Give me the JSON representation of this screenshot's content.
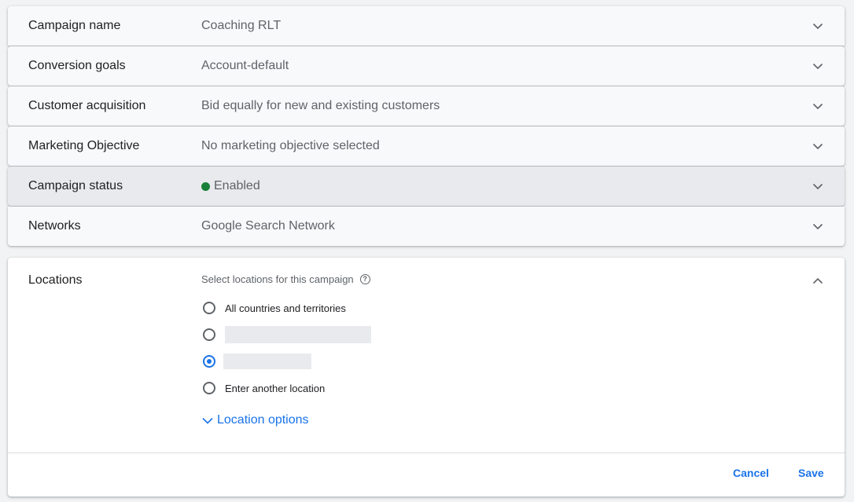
{
  "settings": [
    {
      "label": "Campaign name",
      "value": "Coaching RLT"
    },
    {
      "label": "Conversion goals",
      "value": "Account-default"
    },
    {
      "label": "Customer acquisition",
      "value": "Bid equally for new and existing customers"
    },
    {
      "label": "Marketing Objective",
      "value": "No marketing objective selected"
    },
    {
      "label": "Campaign status",
      "value": "Enabled",
      "status_color": "#188038"
    },
    {
      "label": "Networks",
      "value": "Google Search Network"
    }
  ],
  "locations": {
    "label": "Locations",
    "title": "Select locations for this campaign",
    "options": [
      {
        "label": "All countries and territories",
        "selected": false
      },
      {
        "label": "",
        "selected": false
      },
      {
        "label": "",
        "selected": true
      },
      {
        "label": "Enter another location",
        "selected": false
      }
    ],
    "more_options_label": "Location options",
    "cancel_label": "Cancel",
    "save_label": "Save"
  },
  "colors": {
    "accent": "#1a73e8",
    "status_enabled": "#188038"
  }
}
